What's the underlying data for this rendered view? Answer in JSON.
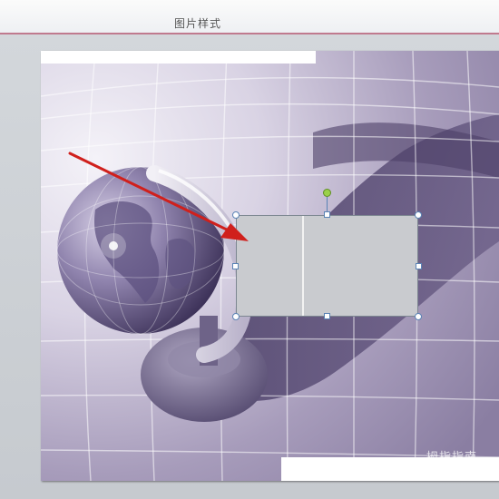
{
  "ribbon": {
    "tab_label": "图片样式"
  },
  "watermark": {
    "text": "拇指指南"
  },
  "colors": {
    "accent_border": "#c07a8e",
    "handle_border": "#5a83b5",
    "rotate_handle": "#9ad14a",
    "arrow": "#d0201c"
  },
  "icons": [
    "rotate-handle-icon",
    "arrow-annotation-icon"
  ]
}
